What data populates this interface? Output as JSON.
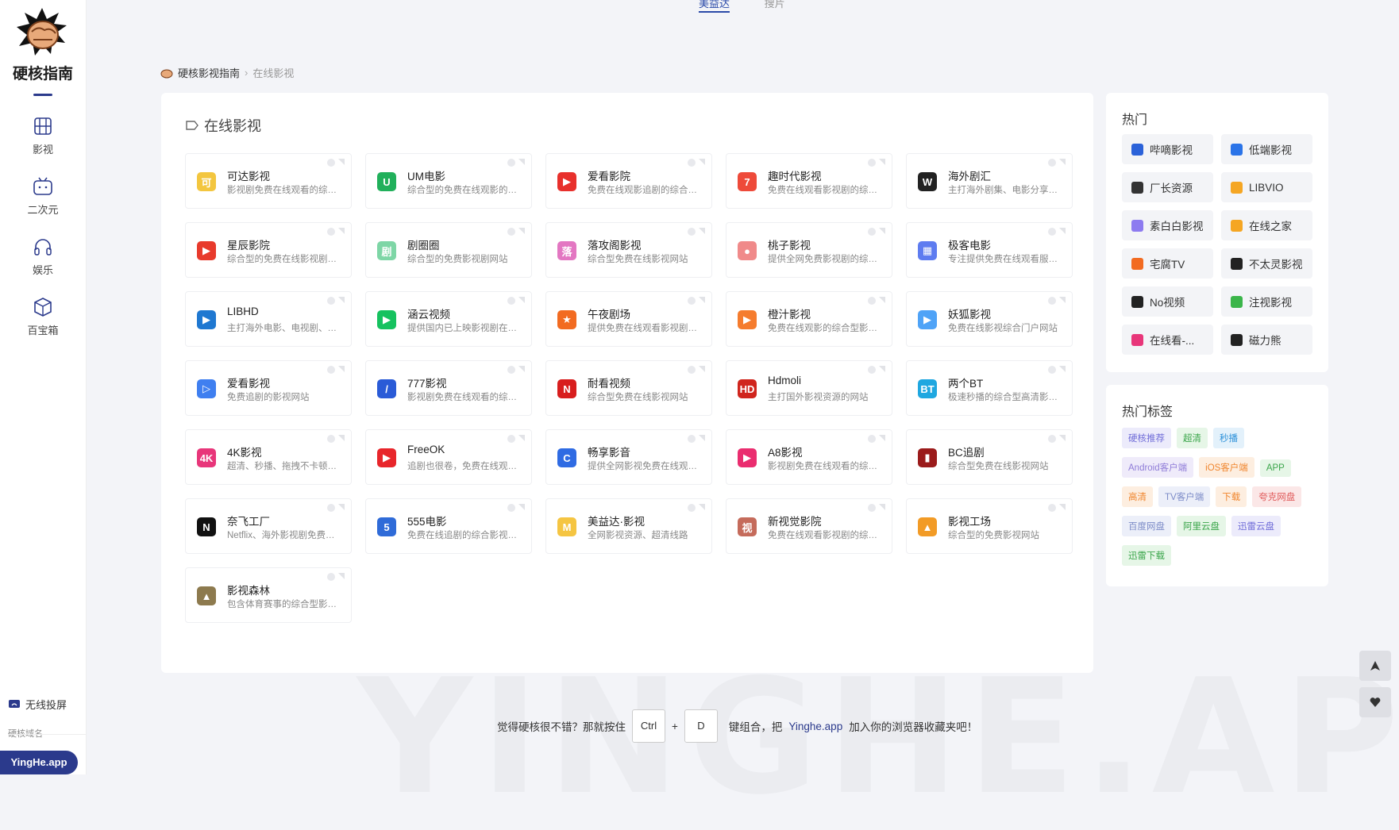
{
  "topnav": {
    "active": "美益达",
    "other": "搜片"
  },
  "sidebar": {
    "brand": "硬核指南",
    "items": [
      {
        "label": "影视",
        "icon": "film-icon"
      },
      {
        "label": "二次元",
        "icon": "tv-face-icon"
      },
      {
        "label": "娱乐",
        "icon": "headphones-icon"
      },
      {
        "label": "百宝箱",
        "icon": "box-icon"
      }
    ],
    "cast_label": "无线投屏",
    "domain_label": "硬核域名",
    "domain": "YingHe.app"
  },
  "breadcrumb": {
    "home": "硬核影视指南",
    "current": "在线影视"
  },
  "section": {
    "title": "在线影视"
  },
  "sites": [
    {
      "name": "可达影视",
      "desc": "影视剧免费在线观看的综合型网站",
      "color": "#f3c63f",
      "glyph": "可"
    },
    {
      "name": "UM电影",
      "desc": "综合型的免费在线观影的影视网站",
      "color": "#21b05b",
      "glyph": "U"
    },
    {
      "name": "爱看影院",
      "desc": "免费在线观影追剧的综合型网站",
      "color": "#e8302c",
      "glyph": "▶"
    },
    {
      "name": "趣时代影视",
      "desc": "免费在线观看影视剧的综合网站",
      "color": "#ee4a3a",
      "glyph": "7"
    },
    {
      "name": "海外剧汇",
      "desc": "主打海外剧集、电影分享的网站",
      "color": "#222222",
      "glyph": "W"
    },
    {
      "name": "星辰影院",
      "desc": "综合型的免费在线影视剧网站",
      "color": "#e83a2c",
      "glyph": "▶"
    },
    {
      "name": "剧圈圈",
      "desc": "综合型的免费影视剧网站",
      "color": "#7ed6a6",
      "glyph": "剧"
    },
    {
      "name": "落攻阁影视",
      "desc": "综合型免费在线影视网站",
      "color": "#e377c2",
      "glyph": "落"
    },
    {
      "name": "桃子影视",
      "desc": "提供全网免费影视剧的综合网站",
      "color": "#f08a8a",
      "glyph": "●"
    },
    {
      "name": "极客电影",
      "desc": "专注提供免费在线观看服务的网站",
      "color": "#5e7cf0",
      "glyph": "▦"
    },
    {
      "name": "LIBHD",
      "desc": "主打海外电影、电视剧、动漫的网站",
      "color": "#1f78d1",
      "glyph": "▶"
    },
    {
      "name": "涵云视频",
      "desc": "提供国内已上映影视剧在线观看",
      "color": "#16c25f",
      "glyph": "▶"
    },
    {
      "name": "午夜剧场",
      "desc": "提供免费在线观看影视剧的综合网站",
      "color": "#f26b21",
      "glyph": "★"
    },
    {
      "name": "橙汁影视",
      "desc": "免费在线观影的综合型影视网站",
      "color": "#f57c2e",
      "glyph": "▶"
    },
    {
      "name": "妖狐影视",
      "desc": "免费在线影视综合门户网站",
      "color": "#4fa3f7",
      "glyph": "▶"
    },
    {
      "name": "爱看影视",
      "desc": "免费追剧的影视网站",
      "color": "#3f7ff0",
      "glyph": "▷"
    },
    {
      "name": "777影视",
      "desc": "影视剧免费在线观看的综合型网站",
      "color": "#2a5bd7",
      "glyph": "/"
    },
    {
      "name": "耐看视频",
      "desc": "综合型免费在线影视网站",
      "color": "#d81e1e",
      "glyph": "N"
    },
    {
      "name": "Hdmoli",
      "desc": "主打国外影视资源的网站",
      "color": "#d0251d",
      "glyph": "HD"
    },
    {
      "name": "两个BT",
      "desc": "极速秒播的综合型高清影视网站",
      "color": "#1fa7e0",
      "glyph": "BT"
    },
    {
      "name": "4K影视",
      "desc": "超清、秒播、拖拽不卡顿的影视网站",
      "color": "#e8367a",
      "glyph": "4K"
    },
    {
      "name": "FreeOK",
      "desc": "追剧也很卷，免费在线观影网站",
      "color": "#e8262b",
      "glyph": "▶"
    },
    {
      "name": "畅享影音",
      "desc": "提供全网影视免费在线观看的网站",
      "color": "#2f6be3",
      "glyph": "C"
    },
    {
      "name": "A8影视",
      "desc": "影视剧免费在线观看的综合型网站",
      "color": "#ea2d6f",
      "glyph": "▶"
    },
    {
      "name": "BC追剧",
      "desc": "综合型免费在线影视网站",
      "color": "#9b1b1b",
      "glyph": "▮"
    },
    {
      "name": "奈飞工厂",
      "desc": "Netflix、海外影视剧免费在线观看",
      "color": "#111111",
      "glyph": "N"
    },
    {
      "name": "555电影",
      "desc": "免费在线追剧的综合影视网站",
      "color": "#2f6bd8",
      "glyph": "5"
    },
    {
      "name": "美益达·影视",
      "desc": "全网影视资源、超清线路",
      "color": "#f5c542",
      "glyph": "M"
    },
    {
      "name": "新视觉影院",
      "desc": "免费在线观看影视剧的综合网站",
      "color": "#c56b5b",
      "glyph": "视"
    },
    {
      "name": "影视工场",
      "desc": "综合型的免费影视网站",
      "color": "#f29b26",
      "glyph": "▲"
    },
    {
      "name": "影视森林",
      "desc": "包含体育赛事的综合型影视网站",
      "color": "#8d7a4e",
      "glyph": "▲"
    }
  ],
  "hot": {
    "title": "热门",
    "items": [
      {
        "label": "哔嘀影视",
        "color": "#2b62d9"
      },
      {
        "label": "低端影视",
        "color": "#2b74e8"
      },
      {
        "label": "厂长资源",
        "color": "#333333"
      },
      {
        "label": "LIBVIO",
        "color": "#f5a623"
      },
      {
        "label": "素白白影视",
        "color": "#8d7bf0"
      },
      {
        "label": "在线之家",
        "color": "#f5a623"
      },
      {
        "label": "宅腐TV",
        "color": "#f26b21"
      },
      {
        "label": "不太灵影视",
        "color": "#222222"
      },
      {
        "label": "No视频",
        "color": "#222222"
      },
      {
        "label": "注视影视",
        "color": "#3bb54a"
      },
      {
        "label": "在线看-...",
        "color": "#e8367a"
      },
      {
        "label": "磁力熊",
        "color": "#222222"
      }
    ]
  },
  "tags": {
    "title": "热门标签",
    "items": [
      {
        "label": "硬核推荐",
        "fg": "#6f6cd8",
        "bg": "#ecebfb"
      },
      {
        "label": "超清",
        "fg": "#3aa54a",
        "bg": "#e6f6e7"
      },
      {
        "label": "秒播",
        "fg": "#2b90d9",
        "bg": "#e3f1fb"
      },
      {
        "label": "Android客户端",
        "fg": "#8f7cd8",
        "bg": "#efebfa"
      },
      {
        "label": "iOS客户端",
        "fg": "#f0852d",
        "bg": "#fdeee0"
      },
      {
        "label": "APP",
        "fg": "#3aa54a",
        "bg": "#e6f6e7"
      },
      {
        "label": "高清",
        "fg": "#f0852d",
        "bg": "#fdeee0"
      },
      {
        "label": "TV客户端",
        "fg": "#7d8cc8",
        "bg": "#eceff9"
      },
      {
        "label": "下载",
        "fg": "#f0852d",
        "bg": "#fdeee0"
      },
      {
        "label": "夸克网盘",
        "fg": "#e05a5a",
        "bg": "#fbe7e7"
      },
      {
        "label": "百度网盘",
        "fg": "#7d8cc8",
        "bg": "#eceff9"
      },
      {
        "label": "阿里云盘",
        "fg": "#3aa54a",
        "bg": "#e6f6e7"
      },
      {
        "label": "迅雷云盘",
        "fg": "#6f6cd8",
        "bg": "#ecebfb"
      },
      {
        "label": "迅雷下载",
        "fg": "#3aa54a",
        "bg": "#e6f6e7"
      }
    ]
  },
  "bottom": {
    "pre": "觉得硬核很不错？那就按住",
    "key1": "Ctrl",
    "plus": "+",
    "key2": "D",
    "mid": "键组合，把",
    "link": "Yinghe.app",
    "post": "加入你的浏览器收藏夹吧！"
  },
  "watermark": "YINGHE.APP"
}
